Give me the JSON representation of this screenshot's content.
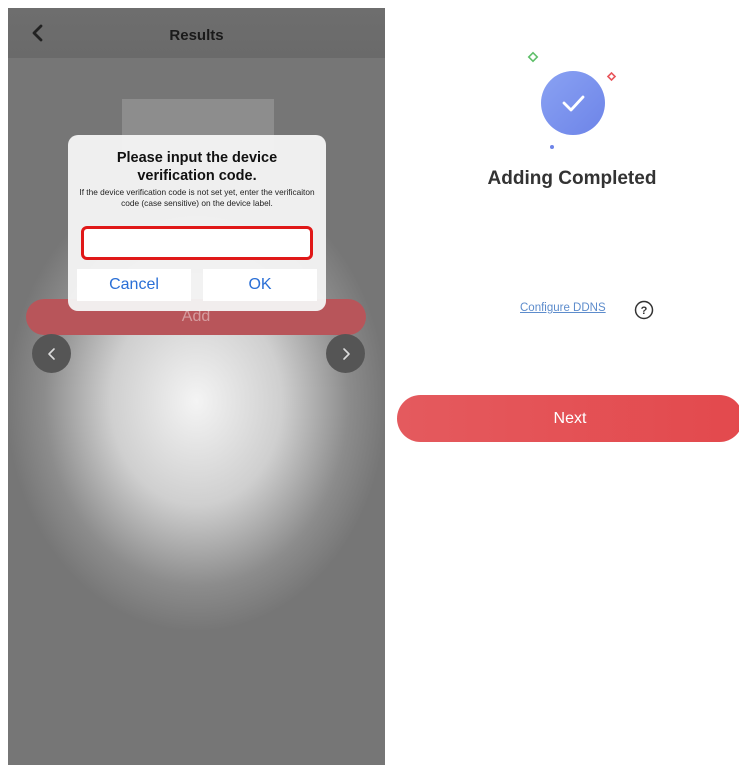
{
  "left_screen": {
    "nav": {
      "title": "Results",
      "back_icon": "chevron-left-icon"
    },
    "add_button_label": "Add",
    "carousel": {
      "prev_icon": "chevron-left-icon",
      "next_icon": "chevron-right-icon"
    },
    "dialog": {
      "title": "Please input the device verification code.",
      "message": "If the device verification code is not set yet, enter the verificaiton code (case sensitive) on the device label.",
      "input_value": "",
      "input_placeholder": "",
      "cancel_label": "Cancel",
      "ok_label": "OK",
      "highlight_color": "#e01818"
    }
  },
  "right_screen": {
    "title": "Adding Completed",
    "icon": "checkmark-circle-icon",
    "ddns_link": "Configure DDNS",
    "help_icon": "question-circle-icon",
    "next_button_label": "Next",
    "accent_color": "#e4565a"
  }
}
